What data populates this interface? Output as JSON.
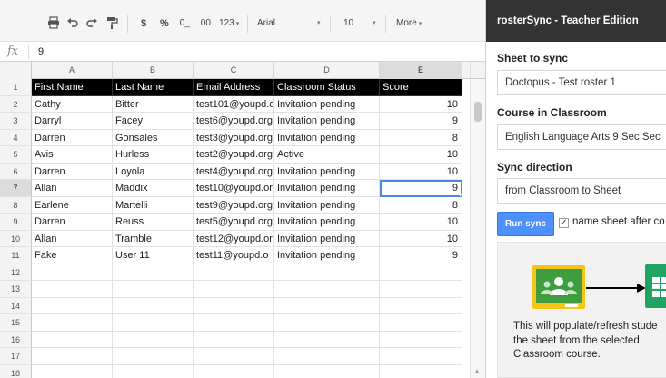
{
  "toolbar": {
    "currency": "$",
    "percent": "%",
    "decrease_decimals": ".0_",
    "increase_decimals": ".00",
    "number_format": "123",
    "font": "Arial",
    "font_size": "10",
    "more": "More",
    "icons": [
      "print-icon",
      "undo-icon",
      "redo-icon",
      "paint-format-icon"
    ]
  },
  "formula_bar": {
    "fx": "fx",
    "value": "9"
  },
  "columns": [
    "A",
    "B",
    "C",
    "D",
    "E"
  ],
  "selected_column": "E",
  "rows": [
    {
      "n": "1",
      "cells": [
        "First Name",
        "Last Name",
        "Email Address",
        "Classroom Status",
        "Score"
      ]
    },
    {
      "n": "2",
      "cells": [
        "Cathy",
        "Bitter",
        "test101@youpd.o",
        "Invitation pending",
        "10"
      ]
    },
    {
      "n": "3",
      "cells": [
        "Darryl",
        "Facey",
        "test6@youpd.org",
        "Invitation pending",
        "9"
      ]
    },
    {
      "n": "4",
      "cells": [
        "Darren",
        "Gonsales",
        "test3@youpd.org",
        "Invitation pending",
        "8"
      ]
    },
    {
      "n": "5",
      "cells": [
        "Avis",
        "Hurless",
        "test2@youpd.org",
        "Active",
        "10"
      ]
    },
    {
      "n": "6",
      "cells": [
        "Darren",
        "Loyola",
        "test4@youpd.org",
        "Invitation pending",
        "10"
      ]
    },
    {
      "n": "7",
      "cells": [
        "Allan",
        "Maddix",
        "test10@youpd.or",
        "Invitation pending",
        "9"
      ]
    },
    {
      "n": "8",
      "cells": [
        "Earlene",
        "Martelli",
        "test9@youpd.org",
        "Invitation pending",
        "8"
      ]
    },
    {
      "n": "9",
      "cells": [
        "Darren",
        "Reuss",
        "test5@youpd.org",
        "Invitation pending",
        "10"
      ]
    },
    {
      "n": "10",
      "cells": [
        "Allan",
        "Tramble",
        "test12@youpd.or",
        "Invitation pending",
        "10"
      ]
    },
    {
      "n": "11",
      "cells": [
        "Fake",
        "User 11",
        "test11@youpd.o",
        "Invitation pending",
        "9"
      ]
    },
    {
      "n": "12",
      "cells": [
        "",
        "",
        "",
        "",
        ""
      ]
    },
    {
      "n": "13",
      "cells": [
        "",
        "",
        "",
        "",
        ""
      ]
    },
    {
      "n": "14",
      "cells": [
        "",
        "",
        "",
        "",
        ""
      ]
    },
    {
      "n": "15",
      "cells": [
        "",
        "",
        "",
        "",
        ""
      ]
    },
    {
      "n": "16",
      "cells": [
        "",
        "",
        "",
        "",
        ""
      ]
    },
    {
      "n": "17",
      "cells": [
        "",
        "",
        "",
        "",
        ""
      ]
    },
    {
      "n": "18",
      "cells": [
        "",
        "",
        "",
        "",
        ""
      ]
    }
  ],
  "active_cell": {
    "row": "7",
    "col": "E"
  },
  "sidebar": {
    "title": "rosterSync - Teacher Edition",
    "sheet_label": "Sheet to sync",
    "sheet_value": "Doctopus - Test roster 1",
    "course_label": "Course in Classroom",
    "course_value": "English Language Arts 9 Sec Sec",
    "direction_label": "Sync direction",
    "direction_value": "from Classroom to Sheet",
    "run_button": "Run sync",
    "checkbox_label": "name sheet after co",
    "checkbox_checked": true,
    "info_lines": [
      "This will populate/refresh stude",
      "the sheet from the selected",
      "Classroom course."
    ],
    "colors": {
      "classroom_green": "#3f9d3f",
      "classroom_yellow": "#f5c518",
      "sheets_green": "#1fa463",
      "button_blue": "#4d90fe",
      "title_bar": "#333333"
    }
  }
}
